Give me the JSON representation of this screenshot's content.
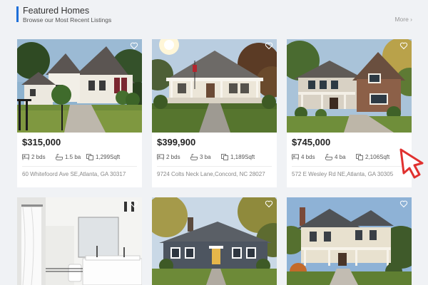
{
  "section": {
    "title": "Featured Homes",
    "subtitle": "Browse our Most Recent Listings",
    "more_label": "More ›"
  },
  "listings": [
    {
      "price": "$315,000",
      "beds": "2 bds",
      "baths": "1.5 ba",
      "sqft": "1,299Sqft",
      "address": "60 Whitefoord Ave SE,Atlanta, GA 30317"
    },
    {
      "price": "$399,900",
      "beds": "2 bds",
      "baths": "3 ba",
      "sqft": "1,189Sqft",
      "address": "9724 Colts Neck Lane,Concord, NC 28027"
    },
    {
      "price": "$745,000",
      "beds": "4 bds",
      "baths": "4 ba",
      "sqft": "2,106Sqft",
      "address": "572 E Wesley Rd NE,Atlanta, GA 30305"
    }
  ],
  "colors": {
    "accent": "#1e6fd9",
    "cursor": "#e0312f"
  }
}
